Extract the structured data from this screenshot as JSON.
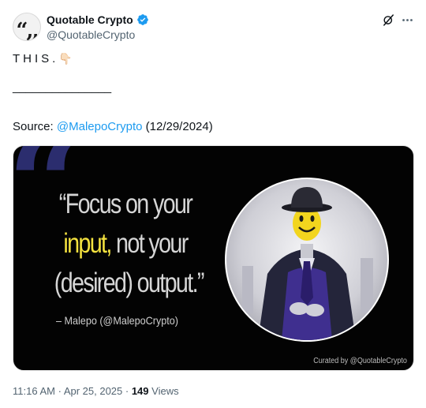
{
  "author": {
    "display_name": "Quotable Crypto",
    "handle": "@QuotableCrypto",
    "avatar_glyph": "“,,"
  },
  "tweet": {
    "line1": "THIS.",
    "line1_emoji": "👇🏻",
    "rule": "_______________",
    "source_label": "Source: ",
    "source_mention": "@MalepoCrypto",
    "source_date": " (12/29/2024)"
  },
  "media": {
    "quote_mark": "“",
    "line1": "“Focus on your",
    "line2_highlight": "input,",
    "line2_rest": " not your",
    "line3": "(desired) output.”",
    "attribution": "– Malepo  (@MalepoCrypto)",
    "curated_by": "Curated by @QuotableCrypto"
  },
  "meta": {
    "time": "11:16 AM",
    "separator1": " · ",
    "date": "Apr 25, 2025",
    "separator2": " · ",
    "views_count": "149",
    "views_label": " Views"
  },
  "colors": {
    "accent": "#1d9bf0",
    "highlight": "#f3e13f",
    "quote_mark": "#2b2d6e"
  },
  "icons": [
    "verified-badge-icon",
    "grok-icon",
    "more-icon"
  ]
}
